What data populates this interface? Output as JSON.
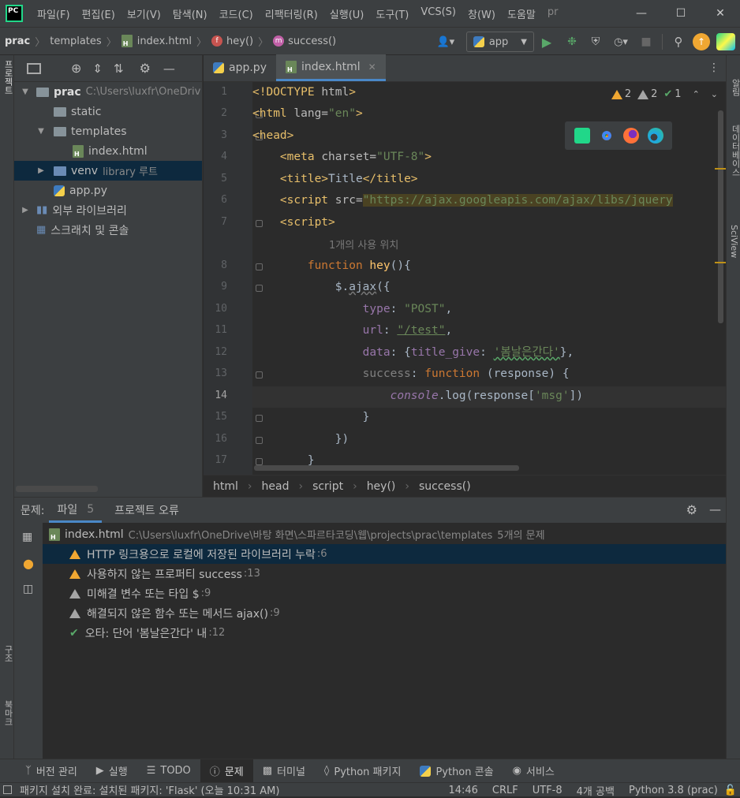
{
  "menu": [
    "파일(F)",
    "편집(E)",
    "보기(V)",
    "탐색(N)",
    "코드(C)",
    "리팩터링(R)",
    "실행(U)",
    "도구(T)",
    "VCS(S)",
    "창(W)",
    "도움말",
    "pr"
  ],
  "logo_text": "PC",
  "breadcrumb": {
    "project": "prac",
    "folder": "templates",
    "file": "index.html",
    "fn1": "hey()",
    "fn2": "success()"
  },
  "run_config": "app",
  "left_strip": [
    "프로젝트"
  ],
  "left_strip_bottom": [
    "구조",
    "북마크"
  ],
  "right_strip": [
    "알림",
    "데이터베이스",
    "SciView"
  ],
  "tree": [
    {
      "label": "prac",
      "hint": "C:\\Users\\luxfr\\OneDriv"
    },
    {
      "label": "static",
      "hint": ""
    },
    {
      "label": "templates",
      "hint": ""
    },
    {
      "label": "index.html",
      "hint": ""
    },
    {
      "label": "venv",
      "hint": "library 루트"
    },
    {
      "label": "app.py",
      "hint": ""
    },
    {
      "label": "외부 라이브러리",
      "hint": ""
    },
    {
      "label": "스크래치 및 콘솔",
      "hint": ""
    }
  ],
  "tabs": [
    {
      "label": "app.py"
    },
    {
      "label": "index.html"
    }
  ],
  "inspections": {
    "warn1": "2",
    "warn2": "2",
    "typo": "1"
  },
  "line_numbers": [
    "1",
    "2",
    "3",
    "4",
    "5",
    "6",
    "7",
    "8",
    "9",
    "10",
    "11",
    "12",
    "13",
    "14",
    "15",
    "16",
    "17"
  ],
  "usage_hint": "1개의 사용 위치",
  "code": {
    "l1a": "<!DOCTYPE ",
    "l1b": "html",
    "l1c": ">",
    "l2a": "<html ",
    "l2b": "lang=",
    "l2c": "\"en\"",
    "l2d": ">",
    "l3": "<head>",
    "l4a": "    <meta ",
    "l4b": "charset=",
    "l4c": "\"UTF-8\"",
    "l4d": ">",
    "l5a": "    <title>",
    "l5b": "Title",
    "l5c": "</title>",
    "l6a": "    <script ",
    "l6b": "src=",
    "l6c": "\"https://ajax.googleapis.com/ajax/libs/jquery",
    "l7": "    <script>",
    "l8a": "        function ",
    "l8b": "hey",
    "l8c": "(){",
    "l9a": "            $.",
    "l9b": "ajax",
    "l9c": "({",
    "l10a": "                type",
    "l10b": ": ",
    "l10c": "\"POST\"",
    "l10d": ",",
    "l11a": "                url",
    "l11b": ": ",
    "l11c": "\"/test\"",
    "l11d": ",",
    "l12a": "                data",
    "l12b": ": {",
    "l12c": "title_give",
    "l12d": ": ",
    "l12e": "'봄날은간다'",
    "l12f": "},",
    "l13a": "                success",
    "l13b": ": ",
    "l13c": "function ",
    "l13d": "(response) {",
    "l14a": "                    ",
    "l14b": "console",
    "l14c": ".log(response[",
    "l14d": "'msg'",
    "l14e": "])",
    "l15": "                }",
    "l16": "            })",
    "l17": "        }"
  },
  "editor_breadcrumb": [
    "html",
    "head",
    "script",
    "hey()",
    "success()"
  ],
  "problems": {
    "title": "문제:",
    "tab_file": "파일",
    "tab_file_count": "5",
    "tab_project": "프로젝트 오류",
    "file": "index.html",
    "file_path": "C:\\Users\\luxfr\\OneDrive\\바탕 화면\\스파르타코딩\\웹\\projects\\prac\\templates",
    "file_count": "5개의 문제",
    "items": [
      {
        "text": "HTTP 링크용으로 로컬에 저장된 라이브러리 누락",
        "line": ":6"
      },
      {
        "text": "사용하지 않는 프로퍼티 success",
        "line": ":13"
      },
      {
        "text": "미해결 변수 또는 타입 $",
        "line": ":9"
      },
      {
        "text": "해결되지 않은 함수 또는 메서드 ajax()",
        "line": ":9"
      },
      {
        "text": "오타: 단어 '봄날은간다' 내",
        "line": ":12"
      }
    ]
  },
  "tool_windows": [
    "버전 관리",
    "실행",
    "TODO",
    "문제",
    "터미널",
    "Python 패키지",
    "Python 콘솔",
    "서비스"
  ],
  "status": {
    "message": "패키지 설치 완료: 설치된 패키지: 'Flask' (오늘 10:31 AM)",
    "position": "14:46",
    "line_sep": "CRLF",
    "encoding": "UTF-8",
    "indent": "4개 공백",
    "interpreter": "Python 3.8 (prac)"
  },
  "colors": {
    "accent": "#4a88c7",
    "selection": "#0d293e",
    "warning": "#f0a732",
    "run": "#59a869"
  }
}
